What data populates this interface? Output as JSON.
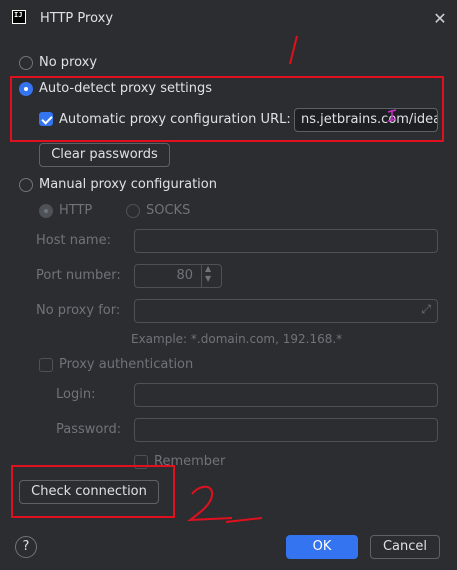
{
  "window": {
    "title": "HTTP Proxy",
    "app_icon_text": "IJ"
  },
  "options": {
    "no_proxy": "No proxy",
    "auto_detect": "Auto-detect proxy settings",
    "auto_config_url_label": "Automatic proxy configuration URL:",
    "auto_config_url_value": "ns.jetbrains.com/idea",
    "clear_passwords": "Clear passwords",
    "manual": "Manual proxy configuration",
    "http": "HTTP",
    "socks": "SOCKS",
    "host_name": "Host name:",
    "port_number": "Port number:",
    "port_value": "80",
    "no_proxy_for": "No proxy for:",
    "example": "Example: *.domain.com, 192.168.*",
    "proxy_auth": "Proxy authentication",
    "login": "Login:",
    "password": "Password:",
    "remember": "Remember"
  },
  "actions": {
    "check_connection": "Check connection",
    "ok": "OK",
    "cancel": "Cancel",
    "help": "?"
  },
  "annotations": {
    "mark1": "1",
    "mark2": "2"
  },
  "colors": {
    "accent": "#3574f0",
    "annotation": "#e0101f",
    "background": "#2b2d30"
  }
}
